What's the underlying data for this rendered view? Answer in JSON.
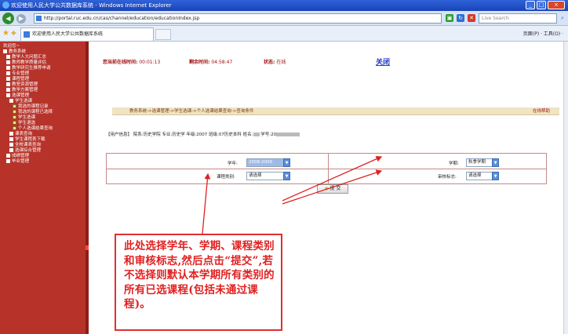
{
  "window": {
    "title": "欢迎使用人民大学公共数据库系统 - Windows Internet Explorer",
    "controls": [
      "_",
      "□",
      "×"
    ]
  },
  "addressbar": {
    "url": "http://portal.ruc.edu.cn/cas/channel/education/educationIndex.jsp",
    "search_placeholder": "Live Search"
  },
  "tabbar": {
    "tab_title": "欢迎使用人民大学公共数据库系统",
    "tools": "页面(P) · 工具(O) ·"
  },
  "sidebar": {
    "items": [
      {
        "label": "欢迎您~",
        "level": 0
      },
      {
        "label": "教务系统",
        "level": 0
      },
      {
        "label": "教学人大问题汇总",
        "level": 1
      },
      {
        "label": "教师教学质量评估",
        "level": 1
      },
      {
        "label": "教学研究生推荐申请",
        "level": 1
      },
      {
        "label": "专业管理",
        "level": 1
      },
      {
        "label": "课程管理",
        "level": 1
      },
      {
        "label": "教室资源管理",
        "level": 1
      },
      {
        "label": "教学方案管理",
        "level": 1
      },
      {
        "label": "选课管理",
        "level": 1
      },
      {
        "label": "学生选课",
        "level": 2
      },
      {
        "label": "我选的课程记录",
        "level": 3
      },
      {
        "label": "我选的课程已选择",
        "level": 3
      },
      {
        "label": "学生选课",
        "level": 3
      },
      {
        "label": "学生退选",
        "level": 3
      },
      {
        "label": "个人选课结果查询",
        "level": 3
      },
      {
        "label": "课表查询",
        "level": 2
      },
      {
        "label": "学生课程表下载",
        "level": 2
      },
      {
        "label": "全校课表查询",
        "level": 2
      },
      {
        "label": "选课综合管理",
        "level": 2
      },
      {
        "label": "成绩管理",
        "level": 1
      },
      {
        "label": "毕业管理",
        "level": 1
      }
    ]
  },
  "status": {
    "online_label": "您当前在线时间:",
    "online_value": "00:01:13",
    "remain_label": "剩余时间:",
    "remain_value": "04:58:47",
    "state_label": "状态:",
    "state_value": "在线",
    "exit_label": "关闭"
  },
  "breadcrumb": {
    "path": "教务系统->选课管理->学生选课->个人选课结果查询->查询条件",
    "help": "在线帮助"
  },
  "user": {
    "text_user": "【用户信息】 院系:历史学院  专业:历史学  年级:2007  班级:07历史本科  姓名:",
    "text_no": "  学号:20"
  },
  "form": {
    "year_label": "学年:",
    "year_value": "2008-2009",
    "term_label": "学期:",
    "term_value": "秋季学期",
    "category_label": "课程类别:",
    "category_value": "请选择",
    "audit_label": "审核标志:",
    "audit_value": "请选择"
  },
  "submit_label": "提 交",
  "note": "此处选择学年、学期、课程类别和审核标志,然后点击“提交”,若不选择则默认本学期所有类别的所有已选课程(包括未通过课程)。"
}
